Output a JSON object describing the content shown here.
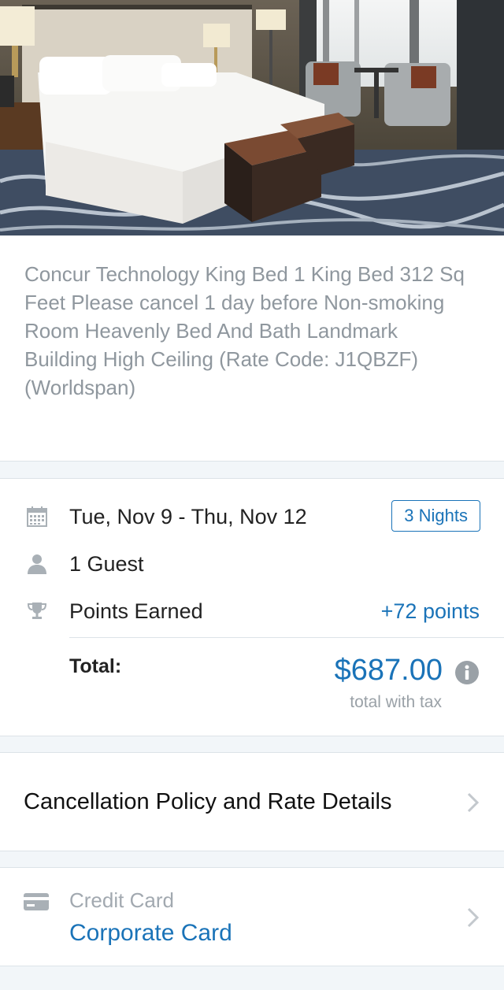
{
  "hotel": {
    "photo_icon": "hotel-room-photo",
    "room_description": "Concur Technology King Bed 1 King Bed 312 Sq Feet Please cancel 1 day before Non-smoking Room Heavenly Bed And Bath Landmark Building High Ceiling (Rate Code: J1QBZF)  (Worldspan)"
  },
  "stay": {
    "dates": "Tue, Nov 9 - Thu, Nov 12",
    "nights_badge": "3 Nights",
    "guests": "1 Guest",
    "points_label": "Points Earned",
    "points_value": "+72 points",
    "total_label": "Total:",
    "total_amount": "$687.00",
    "total_sub": "total with tax",
    "icons": [
      "calendar-icon",
      "person-icon",
      "trophy-icon",
      "info-icon"
    ]
  },
  "cancellation": {
    "label": "Cancellation Policy and Rate Details",
    "icon": "chevron-right-icon"
  },
  "payment": {
    "label": "Credit Card",
    "value": "Corporate Card",
    "icon": "credit-card-icon"
  },
  "colors": {
    "accent": "#1a73b8",
    "background": "#f2f6f9",
    "muted_text": "#8f979e"
  }
}
